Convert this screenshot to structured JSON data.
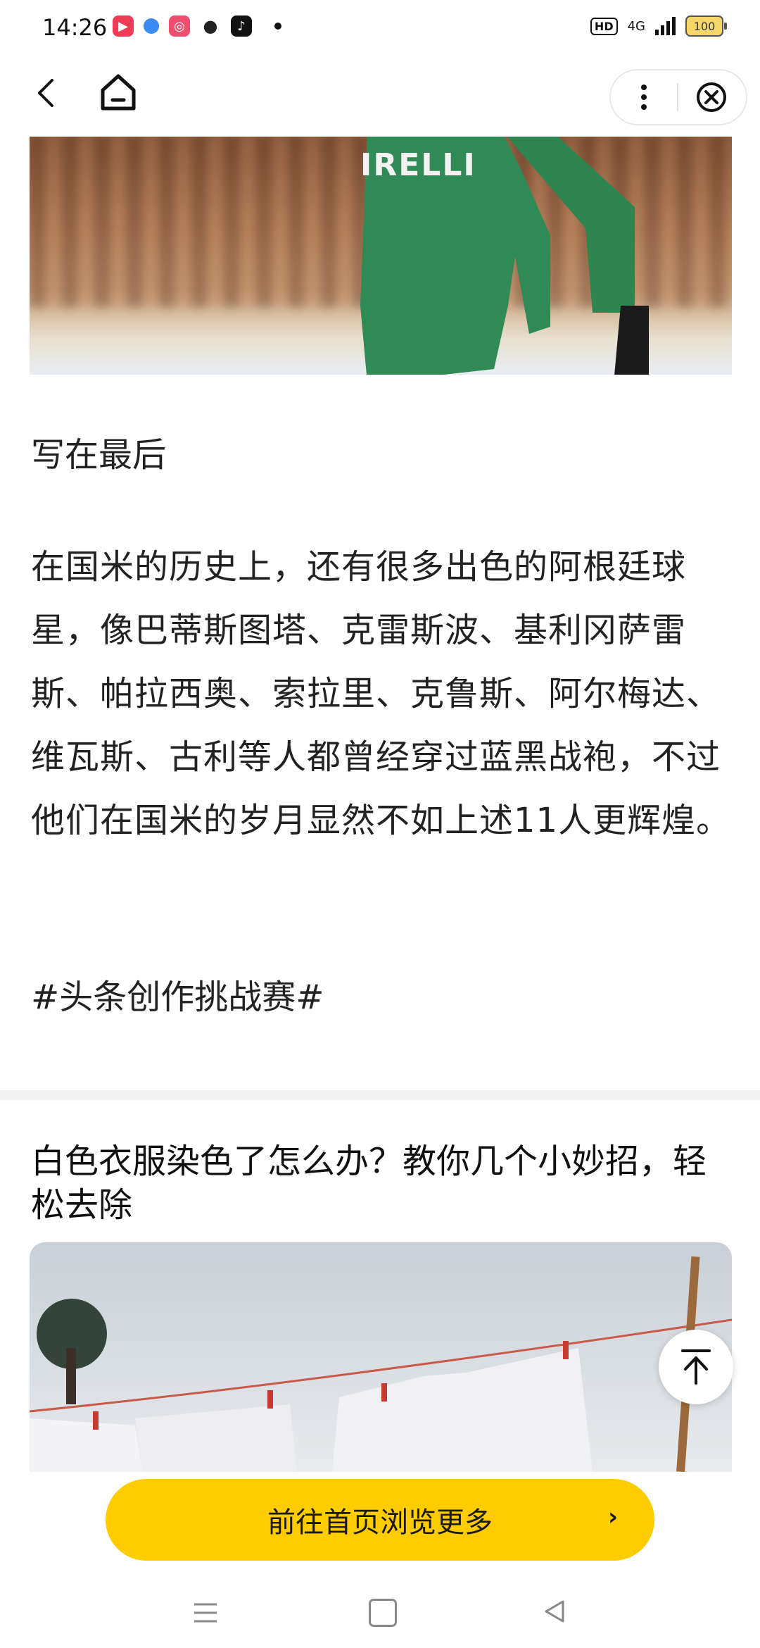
{
  "status_bar": {
    "time": "14:26",
    "network": "4G",
    "battery": "100",
    "hd": "HD",
    "app_icons": [
      "video-app-icon",
      "feather-app-icon",
      "camera-app-icon",
      "wechat-icon",
      "tiktok-icon"
    ]
  },
  "nav": {
    "back_icon": "chevron-left-icon",
    "home_icon": "home-icon",
    "more_icon": "more-vertical-icon",
    "close_icon": "close-circle-icon"
  },
  "article": {
    "image_text": "IRELLI",
    "heading": "写在最后",
    "paragraph": "在国米的历史上，还有很多出色的阿根廷球星，像巴蒂斯图塔、克雷斯波、基利冈萨雷斯、帕拉西奥、索拉里、克鲁斯、阿尔梅达、维瓦斯、古利等人都曾经穿过蓝黑战袍，不过他们在国米的岁月显然不如上述11人更辉煌。",
    "hashtag": "#头条创作挑战赛#"
  },
  "recommendation": {
    "title": "白色衣服染色了怎么办？教你几个小妙招，轻松去除"
  },
  "back_to_top_icon": "arrow-to-top-icon",
  "cta": {
    "label": "前往首页浏览更多",
    "arrow": "›"
  },
  "colors": {
    "cta_background": "#ffcc00",
    "text": "#222222"
  }
}
